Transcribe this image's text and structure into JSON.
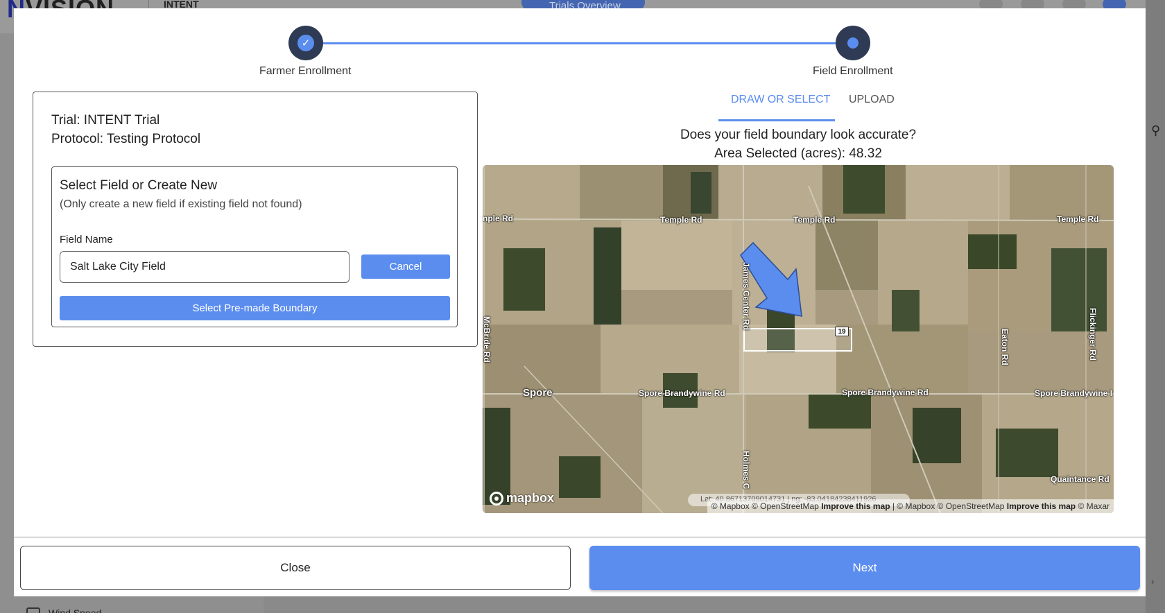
{
  "background": {
    "brand": "INTENT",
    "top_tab": "Trials Overview",
    "sidebar_item": "Wind Speed"
  },
  "stepper": {
    "steps": [
      {
        "label": "Farmer Enrollment",
        "state": "completed"
      },
      {
        "label": "Field Enrollment",
        "state": "active"
      }
    ]
  },
  "left": {
    "trial": "Trial: INTENT Trial",
    "protocol": "Protocol: Testing Protocol",
    "select_title": "Select Field or Create New",
    "select_subtitle": "(Only create a new field if existing field not found)",
    "field_name_label": "Field Name",
    "field_name_value": "Salt Lake City Field",
    "cancel_label": "Cancel",
    "premade_label": "Select Pre-made Boundary"
  },
  "right": {
    "tabs": [
      {
        "label": "DRAW OR SELECT",
        "active": true
      },
      {
        "label": "UPLOAD",
        "active": false
      }
    ],
    "question": "Does your field boundary look accurate?",
    "area_label": "Area Selected (acres): 48.32"
  },
  "map": {
    "roads": {
      "temple_1": "nple Rd",
      "temple_2": "Temple Rd",
      "temple_3": "Temple Rd",
      "temple_4": "Temple Rd",
      "spore_1": "Spore Brandywine Rd",
      "spore_2": "Spore Brandywine Rd",
      "spore_3": "Spore Brandywine I",
      "quaintance": "Quaintance Rd",
      "mcbride": "McBride Rd",
      "james_center": "James Center Rd",
      "holmes": "Holmes C",
      "eaton": "Eaton Rd",
      "flickinger": "Flickinger Rd"
    },
    "town": "Spore",
    "route_number": "19",
    "logo": "mapbox",
    "coordinates": "Lat: 40.86713709014731 | ng: -83.04184238411926",
    "attribution_1": "© Mapbox © OpenStreetMap",
    "improve_1": "Improve this map",
    "attribution_2": "| © Mapbox © OpenStreetMap",
    "improve_2": "Improve this map",
    "attribution_3": "© Maxar"
  },
  "footer": {
    "close_label": "Close",
    "next_label": "Next"
  },
  "colors": {
    "accent": "#5b8def",
    "step_dark": "#2f3b55"
  }
}
